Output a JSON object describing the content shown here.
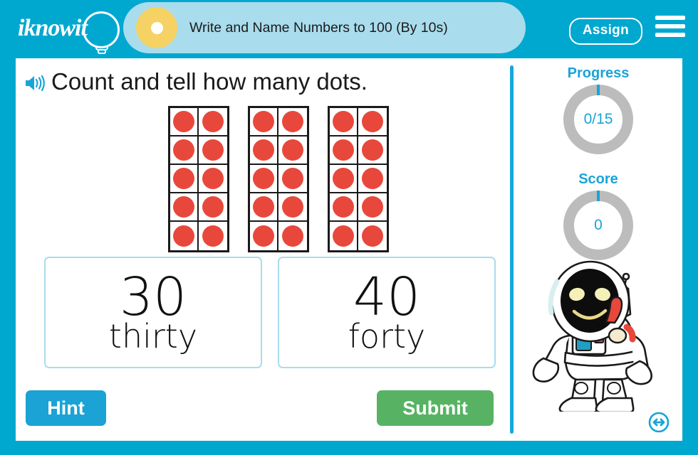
{
  "header": {
    "logo_text": "iknowit",
    "logo_icon": "lightbulb-icon",
    "title": "Write and Name Numbers to 100 (By 10s)",
    "assign_label": "Assign",
    "menu_icon": "hamburger-menu-icon"
  },
  "question": {
    "speaker_icon": "speaker-audio-icon",
    "text": "Count and tell how many dots."
  },
  "manipulative": {
    "type": "ten-frames",
    "frame_count": 3,
    "rows_per_frame": 5,
    "columns_per_frame": 2,
    "dots_per_frame": 10,
    "total_dots": 30,
    "dot_color": "#e8483c"
  },
  "answers": [
    {
      "number": "30",
      "word": "thirty"
    },
    {
      "number": "40",
      "word": "forty"
    }
  ],
  "actions": {
    "hint_label": "Hint",
    "submit_label": "Submit"
  },
  "sidebar": {
    "progress": {
      "label": "Progress",
      "value": "0/15"
    },
    "score": {
      "label": "Score",
      "value": "0"
    },
    "mascot_icon": "astronaut-mascot-icon",
    "resize_icon": "horizontal-resize-icon"
  },
  "colors": {
    "brand_blue": "#00a8d0",
    "accent_blue": "#18a4d8",
    "pill_blue": "#a9dced",
    "yellow": "#f6d264",
    "submit_green": "#57b363",
    "dot_red": "#e8483c",
    "ring_gray": "#bcbcbc"
  }
}
